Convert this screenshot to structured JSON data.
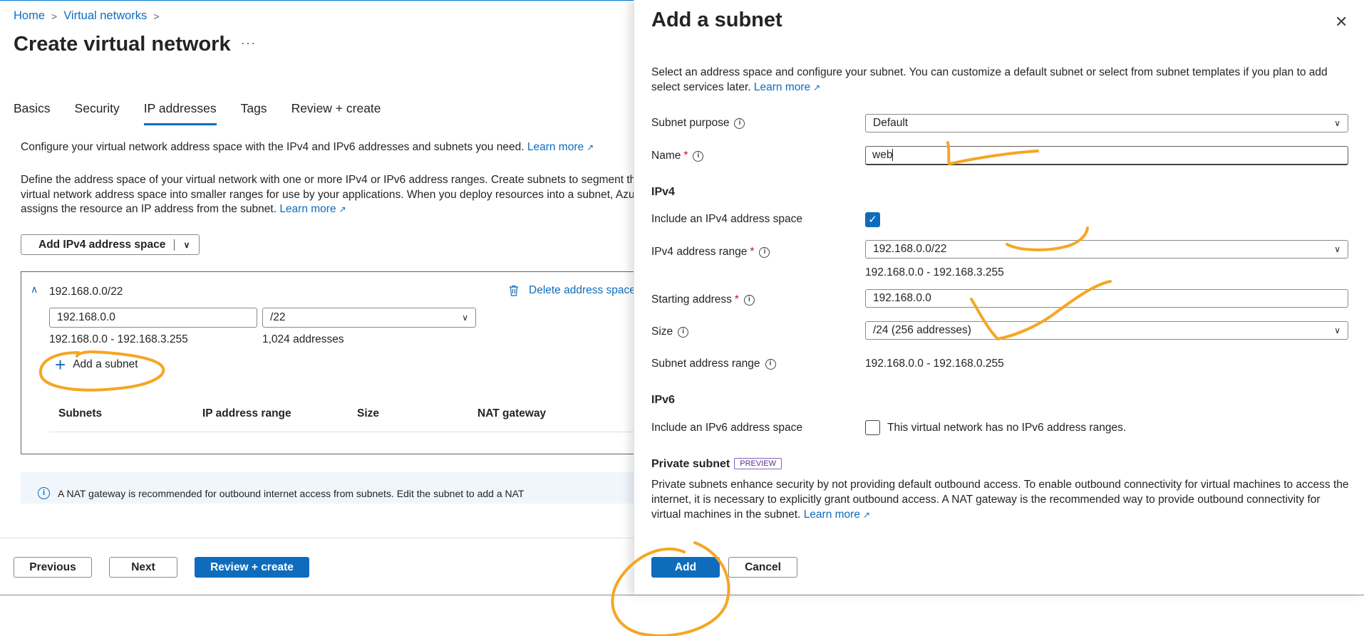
{
  "breadcrumb": {
    "home": "Home",
    "virtual_networks": "Virtual networks"
  },
  "page": {
    "title": "Create virtual network",
    "more": "···"
  },
  "tabs": [
    {
      "label": "Basics"
    },
    {
      "label": "Security"
    },
    {
      "label": "IP addresses"
    },
    {
      "label": "Tags"
    },
    {
      "label": "Review + create"
    }
  ],
  "main": {
    "desc1": "Configure your virtual network address space with the IPv4 and IPv6 addresses and subnets you need.",
    "learn_more": "Learn more",
    "desc2_line1": "Define the address space of your virtual network with one or more IPv4 or IPv6 address ranges. Create subnets to segment th",
    "desc2_line2": "virtual network address space into smaller ranges for use by your applications. When you deploy resources into a subnet, Azu",
    "desc2_line3": "assigns the resource an IP address from the subnet.",
    "add_ipv4_label": "Add IPv4 address space",
    "address_space": {
      "title": "192.168.0.0/22",
      "delete_label": "Delete address space",
      "address_value": "192.168.0.0",
      "cidr_value": "/22",
      "range": "192.168.0.0 - 192.168.3.255",
      "count": "1,024 addresses",
      "add_subnet_label": "Add a subnet",
      "columns": [
        "Subnets",
        "IP address range",
        "Size",
        "NAT gateway"
      ]
    },
    "info_text": "A NAT gateway is recommended for outbound internet access from subnets. Edit the subnet to add a NAT"
  },
  "footer": {
    "previous": "Previous",
    "next": "Next",
    "review_create": "Review + create"
  },
  "panel": {
    "title": "Add a subnet",
    "intro": "Select an address space and configure your subnet. You can customize a default subnet or select from subnet templates if you plan to add select services later.",
    "learn_more": "Learn more",
    "subnet_purpose_label": "Subnet purpose",
    "subnet_purpose_value": "Default",
    "name_label": "Name",
    "name_value": "web",
    "ipv4_section": "IPv4",
    "include_ipv4_label": "Include an IPv4 address space",
    "ipv4_range_label": "IPv4 address range",
    "ipv4_range_value": "192.168.0.0/22",
    "ipv4_range_hint": "192.168.0.0 - 192.168.3.255",
    "starting_address_label": "Starting address",
    "starting_address_value": "192.168.0.0",
    "size_label": "Size",
    "size_value": "/24 (256 addresses)",
    "subnet_range_label": "Subnet address range",
    "subnet_range_value": "192.168.0.0 - 192.168.0.255",
    "ipv6_section": "IPv6",
    "include_ipv6_label": "Include an IPv6 address space",
    "ipv6_checkbox_text": "This virtual network has no IPv6 address ranges.",
    "private_subnet_title": "Private subnet",
    "preview_badge": "PREVIEW",
    "private_desc": "Private subnets enhance security by not providing default outbound access. To enable outbound connectivity for virtual machines to access the internet, it is necessary to explicitly grant outbound access. A NAT gateway is the recommended way to provide outbound connectivity for virtual machines in the subnet.",
    "add_label": "Add",
    "cancel_label": "Cancel"
  },
  "icons": {
    "external": "↗",
    "info": "i",
    "chevron_down": "∨",
    "close": "✕",
    "check": "✓"
  },
  "colors": {
    "accent": "#0f6cbd",
    "annotation": "#f5a623"
  }
}
